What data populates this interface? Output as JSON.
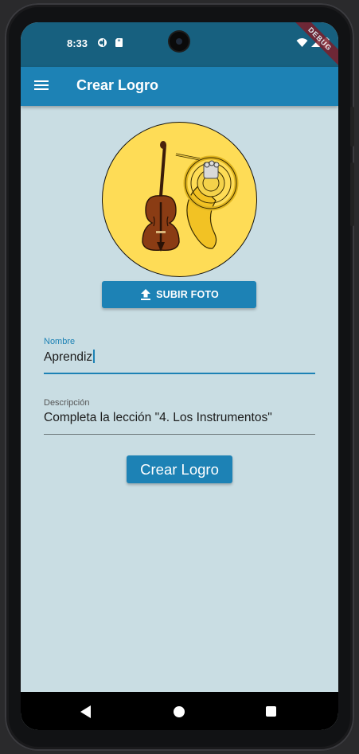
{
  "status_bar": {
    "time": "8:33",
    "debug_banner": "DEBUG"
  },
  "app_bar": {
    "title": "Crear Logro",
    "menu_icon": "menu-icon"
  },
  "photo": {
    "description_icon": "violin-and-french-horn-image",
    "bg_color": "#fedc56"
  },
  "upload_button": {
    "label": "SUBIR FOTO",
    "icon": "upload-icon"
  },
  "form": {
    "name": {
      "label": "Nombre",
      "value": "Aprendiz"
    },
    "description": {
      "label": "Descripción",
      "value": "Completa la lección \"4. Los Instrumentos\""
    }
  },
  "create_button": {
    "label": "Crear Logro"
  },
  "colors": {
    "primary": "#1d82b5",
    "status_bar": "#17607f",
    "background": "#c9dde3"
  }
}
